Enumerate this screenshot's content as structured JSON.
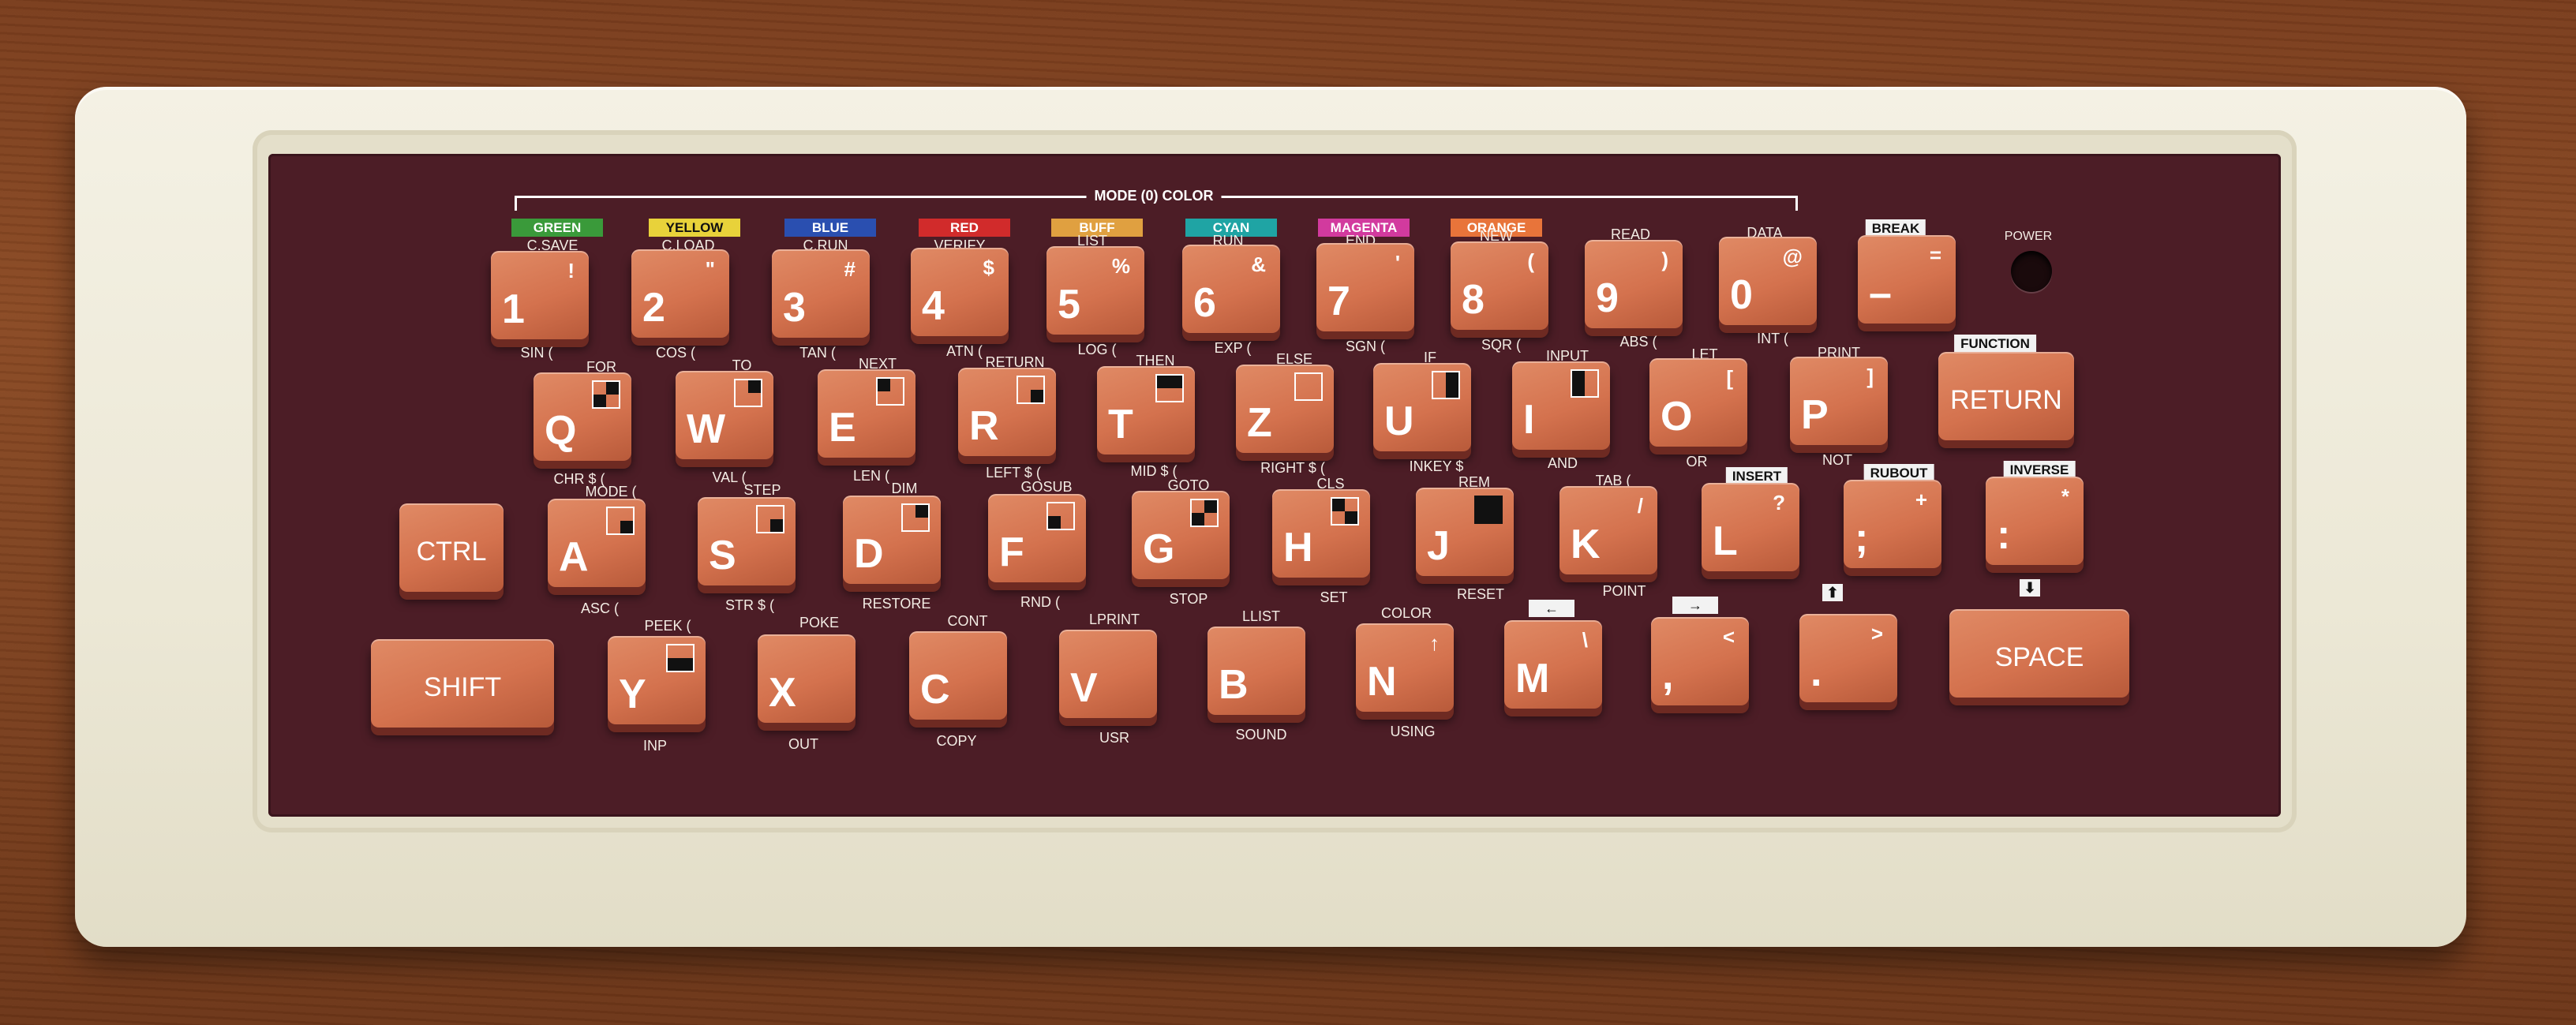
{
  "mode_header": "MODE (0) COLOR",
  "power_label": "POWER",
  "colors": [
    {
      "label": "GREEN",
      "color": "#3a9a3a",
      "text_color": "#ffffff"
    },
    {
      "label": "YELLOW",
      "color": "#e8d23a",
      "text_color": "#111111"
    },
    {
      "label": "BLUE",
      "color": "#2a4fb0",
      "text_color": "#ffffff"
    },
    {
      "label": "RED",
      "color": "#d12b2b",
      "text_color": "#ffffff"
    },
    {
      "label": "BUFF",
      "color": "#e0a040",
      "text_color": "#ffffff"
    },
    {
      "label": "CYAN",
      "color": "#1fa4a4",
      "text_color": "#ffffff"
    },
    {
      "label": "MAGENTA",
      "color": "#d23a9e",
      "text_color": "#ffffff"
    },
    {
      "label": "ORANGE",
      "color": "#e8743a",
      "text_color": "#ffffff"
    }
  ],
  "row1": [
    {
      "main": "1",
      "sym": "!",
      "above": "C.SAVE",
      "below": "SIN ("
    },
    {
      "main": "2",
      "sym": "\"",
      "above": "C.LOAD",
      "below": "COS ("
    },
    {
      "main": "3",
      "sym": "#",
      "above": "C.RUN",
      "below": "TAN ("
    },
    {
      "main": "4",
      "sym": "$",
      "above": "VERIFY",
      "below": "ATN ("
    },
    {
      "main": "5",
      "sym": "%",
      "above": "LIST",
      "below": "LOG ("
    },
    {
      "main": "6",
      "sym": "&",
      "above": "RUN",
      "below": "EXP ("
    },
    {
      "main": "7",
      "sym": "'",
      "above": "END",
      "below": "SGN ("
    },
    {
      "main": "8",
      "sym": "(",
      "above": "NEW",
      "below": "SQR ("
    },
    {
      "main": "9",
      "sym": ")",
      "above": "READ",
      "below": "ABS ("
    },
    {
      "main": "0",
      "sym": "@",
      "above": "DATA",
      "below": "INT ("
    },
    {
      "main": "–",
      "sym": "=",
      "above": "",
      "below": "",
      "tag": "BREAK"
    }
  ],
  "row2": [
    {
      "main": "Q",
      "above": "FOR",
      "below": "CHR $ ("
    },
    {
      "main": "W",
      "above": "TO",
      "below": "VAL ("
    },
    {
      "main": "E",
      "above": "NEXT",
      "below": "LEN ("
    },
    {
      "main": "R",
      "above": "RETURN",
      "below": "LEFT $ ("
    },
    {
      "main": "T",
      "above": "THEN",
      "below": "MID $ ("
    },
    {
      "main": "Z",
      "above": "ELSE",
      "below": "RIGHT $ ("
    },
    {
      "main": "U",
      "above": "IF",
      "below": "INKEY $"
    },
    {
      "main": "I",
      "above": "INPUT",
      "below": "AND"
    },
    {
      "main": "O",
      "sym": "[",
      "above": "LET",
      "below": "OR"
    },
    {
      "main": "P",
      "sym": "]",
      "above": "PRINT",
      "below": "NOT"
    },
    {
      "main": "RETURN",
      "tag": "FUNCTION"
    }
  ],
  "row3": [
    {
      "main": "CTRL"
    },
    {
      "main": "A",
      "above": "MODE (",
      "below": "ASC ("
    },
    {
      "main": "S",
      "above": "STEP",
      "below": "STR $ ("
    },
    {
      "main": "D",
      "above": "DIM",
      "below": "RESTORE"
    },
    {
      "main": "F",
      "above": "GOSUB",
      "below": "RND ("
    },
    {
      "main": "G",
      "above": "GOTO",
      "below": "STOP"
    },
    {
      "main": "H",
      "above": "CLS",
      "below": "SET"
    },
    {
      "main": "J",
      "above": "REM",
      "below": "RESET"
    },
    {
      "main": "K",
      "sym": "/",
      "above": "TAB (",
      "below": "POINT"
    },
    {
      "main": "L",
      "sym": "?",
      "tag": "INSERT"
    },
    {
      "main": ";",
      "sym": "+",
      "tag": "RUBOUT"
    },
    {
      "main": ":",
      "sym": "*",
      "tag": "INVERSE"
    }
  ],
  "row4": [
    {
      "main": "SHIFT"
    },
    {
      "main": "Y",
      "above": "PEEK (",
      "below": "INP"
    },
    {
      "main": "X",
      "above": "POKE",
      "below": "OUT"
    },
    {
      "main": "C",
      "above": "CONT",
      "below": "COPY"
    },
    {
      "main": "V",
      "above": "LPRINT",
      "below": "USR"
    },
    {
      "main": "B",
      "above": "LLIST",
      "below": "SOUND"
    },
    {
      "main": "N",
      "sym": "↑",
      "above": "COLOR",
      "below": "USING"
    },
    {
      "main": "M",
      "sym": "\\",
      "arrow": "←"
    },
    {
      "main": ",",
      "sym": "<",
      "arrow": "→"
    },
    {
      "main": ".",
      "sym": ">",
      "arrow": "⬆"
    },
    {
      "main": "SPACE",
      "arrow": "⬇"
    }
  ]
}
